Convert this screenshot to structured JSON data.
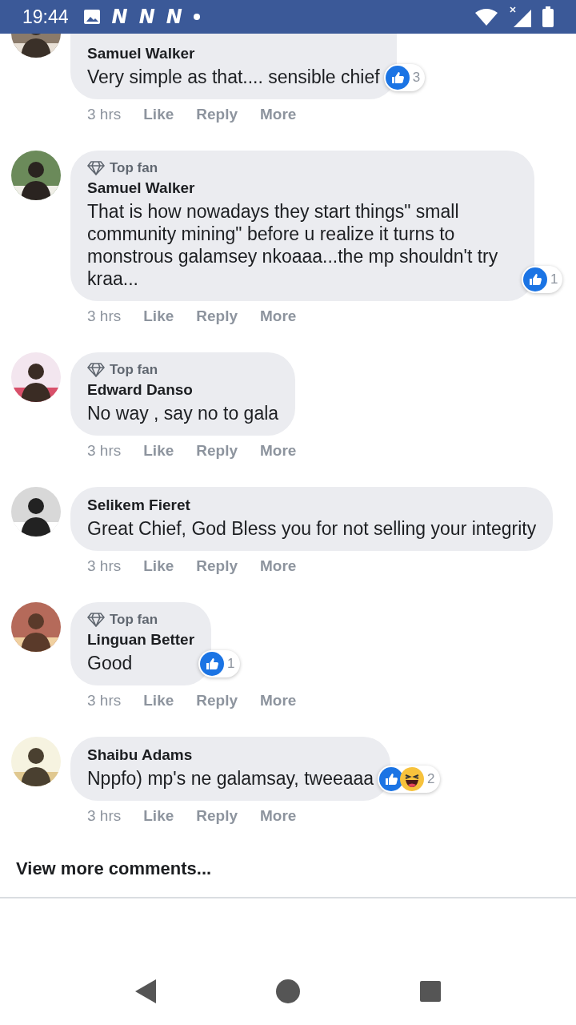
{
  "status_bar": {
    "time": "19:44",
    "notifications": [
      "N",
      "N",
      "N"
    ]
  },
  "comments": [
    {
      "author": "Samuel Walker",
      "text": "Very simple as that.... sensible chief",
      "reactions": [
        {
          "kind": "like"
        }
      ],
      "reaction_count": "3",
      "time": "3 hrs",
      "actions": [
        "Like",
        "Reply",
        "More"
      ]
    },
    {
      "author": "Samuel Walker",
      "badge": "Top fan",
      "text": "That is how nowadays they start things\" small community mining\" before u realize it turns to monstrous galamsey nkoaaa...the mp shouldn't try kraa...",
      "reactions": [
        {
          "kind": "like"
        }
      ],
      "reaction_count": "1",
      "time": "3 hrs",
      "actions": [
        "Like",
        "Reply",
        "More"
      ]
    },
    {
      "author": "Edward Danso",
      "badge": "Top fan",
      "text": "No way , say no to gala",
      "time": "3 hrs",
      "actions": [
        "Like",
        "Reply",
        "More"
      ]
    },
    {
      "author": "Selikem Fieret",
      "text": "Great Chief, God Bless you for not selling your integrity",
      "time": "3 hrs",
      "actions": [
        "Like",
        "Reply",
        "More"
      ]
    },
    {
      "author": "Linguan Better",
      "badge": "Top fan",
      "text": "Good",
      "reactions": [
        {
          "kind": "like"
        }
      ],
      "reaction_count": "1",
      "time": "3 hrs",
      "actions": [
        "Like",
        "Reply",
        "More"
      ]
    },
    {
      "author": "Shaibu Adams",
      "text": "Nppfo) mp's ne galamsay, tweeaaa",
      "reactions": [
        {
          "kind": "like"
        },
        {
          "kind": "haha"
        }
      ],
      "reaction_count": "2",
      "time": "3 hrs",
      "actions": [
        "Like",
        "Reply",
        "More"
      ]
    }
  ],
  "view_more": "View more comments..."
}
